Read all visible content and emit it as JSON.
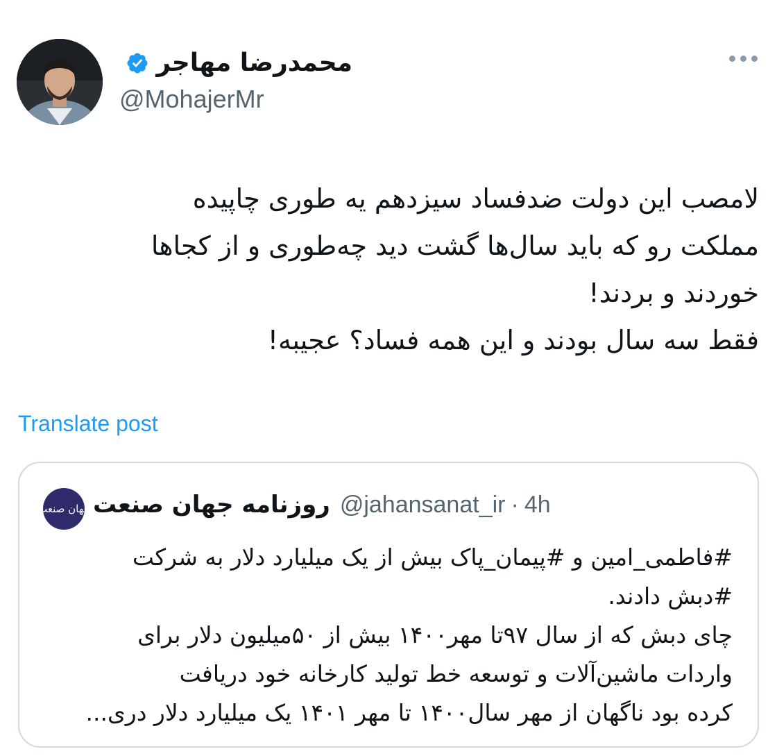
{
  "author": {
    "display_name": "محمدرضا مهاجر",
    "handle": "@MohajerMr",
    "verified": true,
    "avatar": "profile-photo"
  },
  "more_icon": "ellipsis-horizontal-icon",
  "tweet_lines": [
    "لامصب این دولت ضدفساد سیزدهم یه طوری چاپیده",
    "مملکت رو که باید سال‌ها گشت دید چه‌طوری و از کجاها",
    "خوردند و بردند!",
    "فقط سه سال بودند و این همه فساد؟ عجیبه!"
  ],
  "translate_label": "Translate post",
  "quote": {
    "avatar_text": "جهان صنعت",
    "display_name": "روزنامه جهان صنعت",
    "handle": "@jahansanat_ir",
    "separator": "·",
    "time": "4h",
    "lines": [
      "#فاطمی_امین و #پیمان_پاک بیش از یک میلیارد دلار به شرکت",
      "#دبش دادند.",
      "چای دبش که از سال ۹۷تا مهر۱۴۰۰ بیش از ۵۰میلیون دلار برای",
      "واردات ماشین‌آلات و توسعه خط تولید کارخانه خود دریافت",
      "کرده بود ناگهان از مهر سال۱۴۰۰ تا مهر ۱۴۰۱ یک میلیارد دلار دری..."
    ]
  },
  "colors": {
    "accent": "#1d9bf0",
    "text": "#0f1419",
    "secondary": "#536471",
    "border": "#cfd9de",
    "quote_avatar_bg": "#2e2b6b"
  }
}
